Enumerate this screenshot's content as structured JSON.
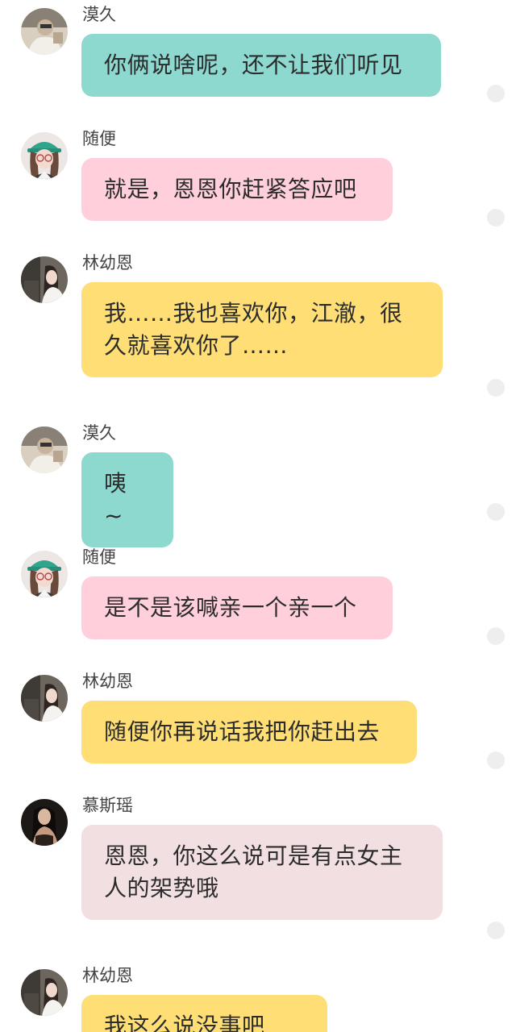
{
  "colors": {
    "teal_bubble": "#8dd9d0",
    "pink_bubble": "#ffd0dc",
    "yellow_bubble": "#ffdf75",
    "mauve_bubble": "#f1dfe2",
    "background": "#ffffff",
    "read_dot": "#eeeeee"
  },
  "messages": [
    {
      "sender": "漠久",
      "text": "你俩说啥呢，还不让我们听见",
      "avatar_icon": "avatar-mojiu-icon",
      "bubble_color": "teal"
    },
    {
      "sender": "随便",
      "text": "就是，恩恩你赶紧答应吧",
      "avatar_icon": "avatar-suibian-icon",
      "bubble_color": "pink"
    },
    {
      "sender": "林幼恩",
      "text": "我……我也喜欢你，江澈，很久就喜欢你了……",
      "avatar_icon": "avatar-linyouen-icon",
      "bubble_color": "yellow"
    },
    {
      "sender": "漠久",
      "text": "咦 ~",
      "avatar_icon": "avatar-mojiu-icon",
      "bubble_color": "teal"
    },
    {
      "sender": "随便",
      "text": "是不是该喊亲一个亲一个",
      "avatar_icon": "avatar-suibian-icon",
      "bubble_color": "pink"
    },
    {
      "sender": "林幼恩",
      "text": "随便你再说话我把你赶出去",
      "avatar_icon": "avatar-linyouen-icon",
      "bubble_color": "yellow"
    },
    {
      "sender": "慕斯瑶",
      "text": "恩恩，你这么说可是有点女主人的架势哦",
      "avatar_icon": "avatar-musiyao-icon",
      "bubble_color": "mauve"
    },
    {
      "sender": "林幼恩",
      "text": "我这么说没事吧",
      "avatar_icon": "avatar-linyouen-icon",
      "bubble_color": "yellow"
    }
  ]
}
